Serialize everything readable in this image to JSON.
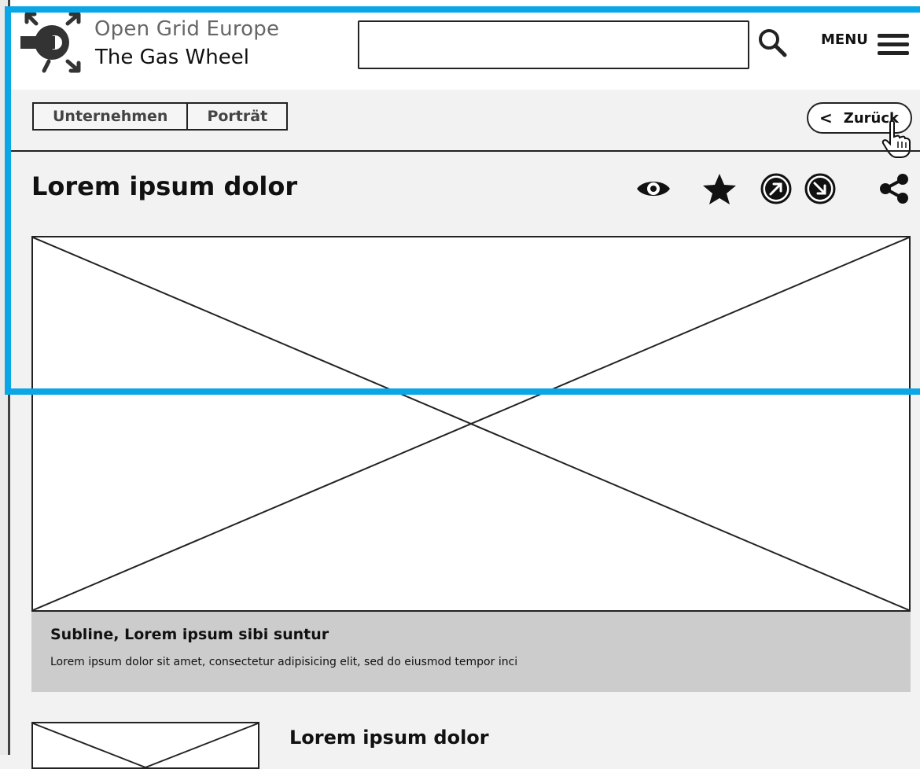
{
  "header": {
    "brand_line1": "Open Grid Europe",
    "brand_line2": "The Gas Wheel",
    "search_value": "",
    "menu_label": "MENU"
  },
  "breadcrumb": [
    "Unternehmen",
    "Porträt"
  ],
  "back_button": {
    "chevron": "<",
    "label": "Zurück"
  },
  "main": {
    "title": "Lorem ipsum dolor",
    "actions": [
      "eye-icon",
      "star-icon",
      "arrow-up-right-circle-icon",
      "arrow-down-right-circle-icon",
      "share-icon"
    ],
    "caption_title": "Subline, Lorem ipsum sibi suntur",
    "caption_text": "Lorem ipsum dolor sit amet, consectetur adipisicing elit, sed do eiusmod tempor inci"
  },
  "teaser": {
    "title": "Lorem ipsum dolor"
  },
  "colors": {
    "selection": "#0aa7e6",
    "caption_bg": "#cccccc",
    "page_bg": "#f2f2f2"
  }
}
